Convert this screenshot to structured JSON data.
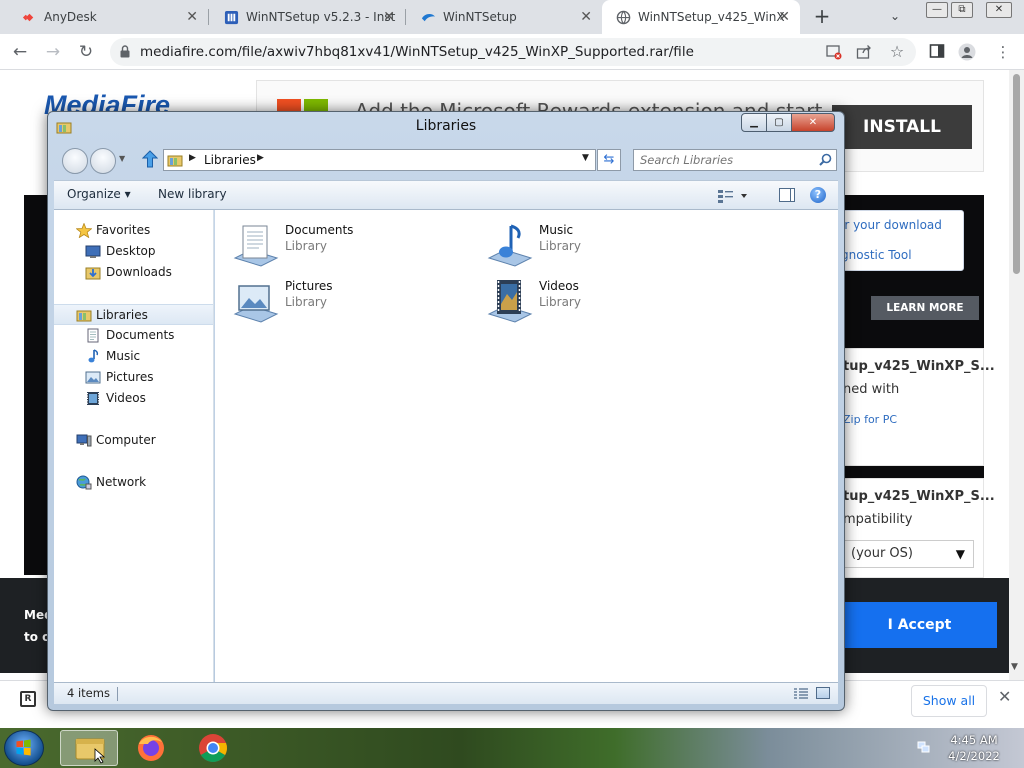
{
  "browser": {
    "tabs": [
      {
        "title": "AnyDesk",
        "favicon": "anydesk-icon",
        "color": "#ef443b"
      },
      {
        "title": "WinNTSetup v5.2.3 - Inst",
        "favicon": "winntsetup-icon",
        "color": "#2d5fb8"
      },
      {
        "title": "WinNTSetup",
        "favicon": "winntsetup-blue-icon",
        "color": "#1f78d1"
      },
      {
        "title": "WinNTSetup_v425_WinX",
        "favicon": "globe-icon",
        "color": "#5f6368"
      }
    ],
    "new_tab_label": "+",
    "tab_menu_label": "⌄",
    "window_controls": {
      "minimize": "—",
      "restore": "⧉",
      "close": "✕"
    },
    "url": "mediafire.com/file/axwiv7hbq81xv41/WinNTSetup_v425_WinXP_Supported.rar/file",
    "toolbar_icons": [
      "back-icon",
      "forward-icon",
      "reload-icon",
      "lock-icon",
      "blocked-popup-icon",
      "share-icon",
      "star-icon",
      "sidepanel-icon",
      "profile-icon",
      "menu-icon"
    ]
  },
  "webpage": {
    "logo": "MediaFire",
    "ad_text": "Add the Microsoft Rewards extension and start earning rewards for doing what you love",
    "install_label": "INSTALL",
    "info_card": {
      "line1": "ir your download",
      "line2": "gnostic Tool"
    },
    "learn_more_label": "LEARN MORE",
    "card1": {
      "title": "tup_v425_WinXP_S...",
      "subtitle": "ned with",
      "link": "Zip for PC"
    },
    "card2": {
      "title": "tup_v425_WinXP_S...",
      "subtitle": "mpatibility"
    },
    "os_select": "(your OS)",
    "cookie_text": [
      "Med",
      "to o"
    ],
    "accept_label": "I Accept",
    "colors": {
      "accent": "#1570ef",
      "dark_panel": "#0b0b0d"
    }
  },
  "download_bar": {
    "show_all_label": "Show all",
    "close_label": "✕"
  },
  "taskbar": {
    "apps": [
      "explorer-icon",
      "firefox-icon",
      "chrome-icon"
    ],
    "time": "4:45 AM",
    "date": "4/2/2022"
  },
  "explorer": {
    "title": "Libraries",
    "controls": {
      "minimize": "▁",
      "maximize": "▢",
      "close": "✕"
    },
    "address": "Libraries",
    "search_placeholder": "Search Libraries",
    "commands": {
      "organize": "Organize ▾",
      "new_library": "New library"
    },
    "nav": {
      "favorites": {
        "label": "Favorites",
        "items": [
          "Desktop",
          "Downloads"
        ]
      },
      "libraries": {
        "label": "Libraries",
        "items": [
          "Documents",
          "Music",
          "Pictures",
          "Videos"
        ]
      },
      "computer": "Computer",
      "network": "Network"
    },
    "libraries": [
      {
        "name": "Documents",
        "type": "Library"
      },
      {
        "name": "Music",
        "type": "Library"
      },
      {
        "name": "Pictures",
        "type": "Library"
      },
      {
        "name": "Videos",
        "type": "Library"
      }
    ],
    "status_count": "4 items"
  }
}
